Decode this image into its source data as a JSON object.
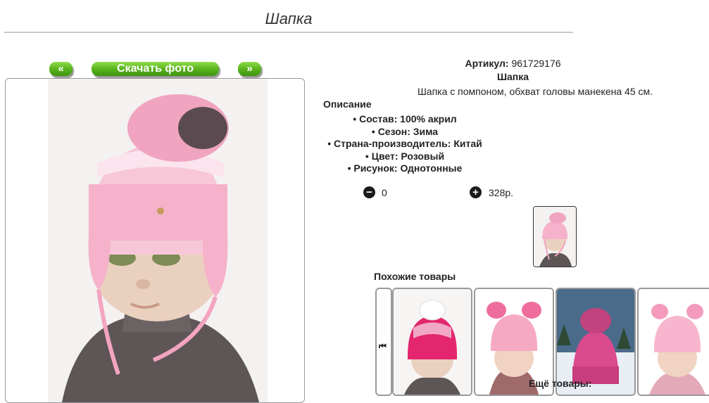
{
  "page": {
    "title": "Шапка"
  },
  "nav": {
    "prev_label": "«",
    "download_label": "Скачать фото",
    "next_label": "»"
  },
  "product": {
    "article_label": "Артикул:",
    "article_value": "961729176",
    "name": "Шапка",
    "short_desc": "Шапка с помпоном, обхват головы манекена 45 см.",
    "desc_heading": "Описание",
    "props": [
      "Состав: 100% акрил",
      "Сезон: Зима",
      "Страна-производитель: Китай",
      "Цвет: Розовый",
      "Рисунок: Однотонные"
    ]
  },
  "cart": {
    "minus": "−",
    "plus": "+",
    "quantity": "0",
    "price": "328р."
  },
  "similar": {
    "heading": "Похожие товары",
    "carousel_prev": "⏮"
  },
  "more": {
    "heading": "Ещё товары:"
  }
}
